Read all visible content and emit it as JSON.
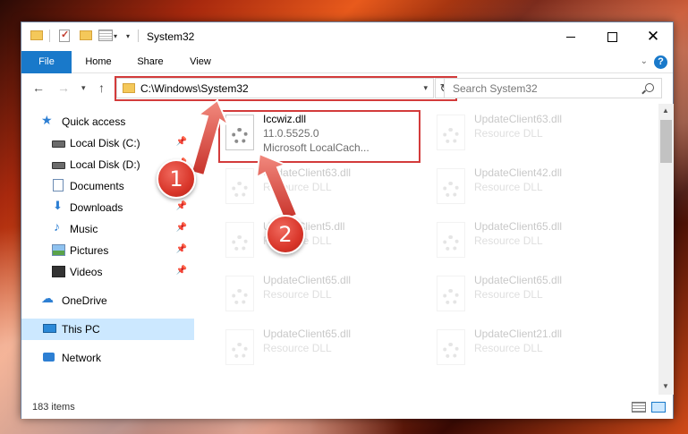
{
  "window": {
    "title": "System32"
  },
  "ribbon": {
    "tabs": [
      "File",
      "Home",
      "Share",
      "View"
    ]
  },
  "address": {
    "path": "C:\\Windows\\System32",
    "search_placeholder": "Search System32"
  },
  "sidebar": {
    "items": [
      {
        "label": "Quick access",
        "icon": "star-icon",
        "pinned": false
      },
      {
        "label": "Local Disk (C:)",
        "icon": "disk-icon",
        "pinned": true
      },
      {
        "label": "Local Disk (D:)",
        "icon": "disk-icon",
        "pinned": true
      },
      {
        "label": "Documents",
        "icon": "document-icon",
        "pinned": true
      },
      {
        "label": "Downloads",
        "icon": "download-icon",
        "pinned": true
      },
      {
        "label": "Music",
        "icon": "music-icon",
        "pinned": true
      },
      {
        "label": "Pictures",
        "icon": "picture-icon",
        "pinned": true
      },
      {
        "label": "Videos",
        "icon": "video-icon",
        "pinned": true
      },
      {
        "label": "OneDrive",
        "icon": "cloud-icon",
        "pinned": false
      },
      {
        "label": "This PC",
        "icon": "computer-icon",
        "pinned": false,
        "selected": true
      },
      {
        "label": "Network",
        "icon": "network-icon",
        "pinned": false
      }
    ]
  },
  "files": [
    {
      "name": "Iccwiz.dll",
      "version": "11.0.5525.0",
      "description": "Microsoft LocalCach...",
      "highlighted": true
    },
    {
      "name": "UpdateClient63.dll",
      "version": "",
      "description": "Resource DLL"
    },
    {
      "name": "UpdateClient63.dll",
      "version": "",
      "description": "Resource DLL"
    },
    {
      "name": "UpdateClient42.dll",
      "version": "",
      "description": "Resource DLL"
    },
    {
      "name": "UpdateClient5.dll",
      "version": "",
      "description": "Resource DLL"
    },
    {
      "name": "UpdateClient65.dll",
      "version": "",
      "description": "Resource DLL"
    },
    {
      "name": "UpdateClient65.dll",
      "version": "",
      "description": "Resource DLL"
    },
    {
      "name": "UpdateClient65.dll",
      "version": "",
      "description": "Resource DLL"
    },
    {
      "name": "UpdateClient65.dll",
      "version": "",
      "description": "Resource DLL"
    },
    {
      "name": "UpdateClient21.dll",
      "version": "",
      "description": "Resource DLL"
    }
  ],
  "status": {
    "items_count": "183 items"
  },
  "callouts": [
    "1",
    "2"
  ],
  "colors": {
    "accent": "#1979ca",
    "highlight": "#d33b3b",
    "selected": "#cce8ff"
  }
}
